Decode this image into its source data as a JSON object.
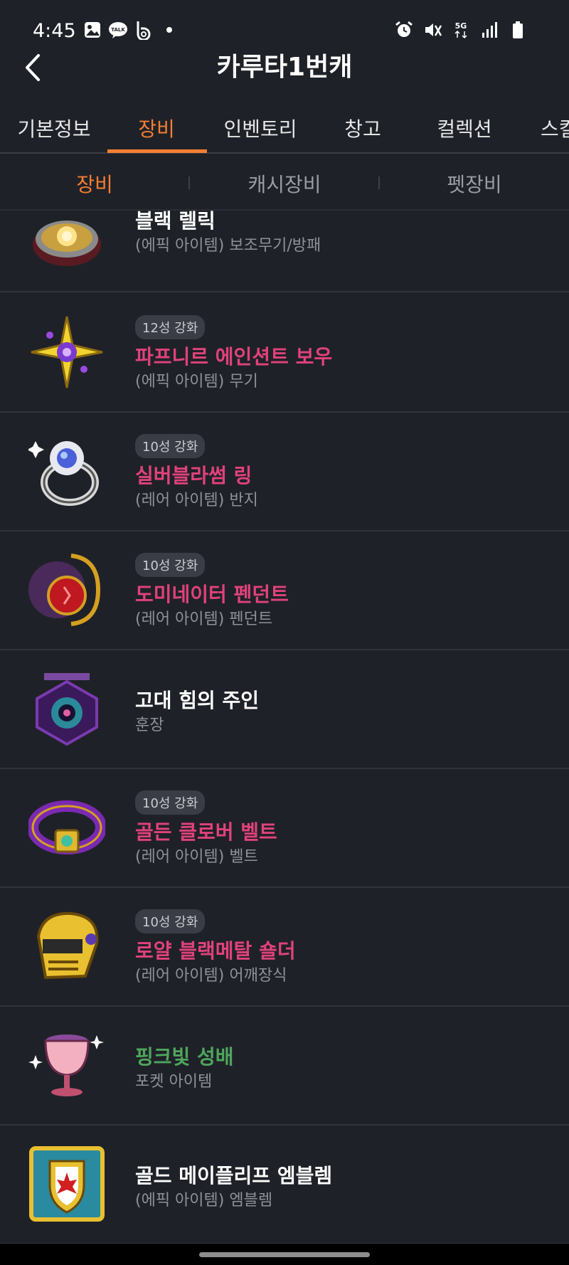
{
  "status": {
    "time": "4:45",
    "left_icons": [
      "gallery-icon",
      "kakaotalk-icon",
      "b-app-icon",
      "dot-icon"
    ],
    "talk_label": "TALK",
    "right_icons": [
      "alarm-icon",
      "mute-icon",
      "5g-icon",
      "signal-icon",
      "battery-icon"
    ],
    "network": "5G"
  },
  "header": {
    "title": "카루타1번캐"
  },
  "tabs": [
    {
      "label": "기본정보"
    },
    {
      "label": "장비"
    },
    {
      "label": "인벤토리"
    },
    {
      "label": "창고"
    },
    {
      "label": "컬렉션"
    },
    {
      "label": "스킬"
    }
  ],
  "active_tab": "장비",
  "subtabs": [
    {
      "label": "장비"
    },
    {
      "label": "캐시장비"
    },
    {
      "label": "펫장비"
    }
  ],
  "active_subtab": "장비",
  "items": [
    {
      "name": "블랙 렐릭",
      "sub": "(에픽 아이템) 보조무기/방패",
      "badge": "",
      "color": "white",
      "icon": "relic-icon"
    },
    {
      "name": "파프니르 에인션트 보우",
      "sub": "(에픽 아이템) 무기",
      "badge": "12성 강화",
      "color": "pink",
      "icon": "bow-icon"
    },
    {
      "name": "실버블라썸 링",
      "sub": "(레어 아이템) 반지",
      "badge": "10성 강화",
      "color": "pink",
      "icon": "ring-icon"
    },
    {
      "name": "도미네이터 펜던트",
      "sub": "(레어 아이템) 펜던트",
      "badge": "10성 강화",
      "color": "pink",
      "icon": "pendant-icon"
    },
    {
      "name": "고대 힘의 주인",
      "sub": "훈장",
      "badge": "",
      "color": "white",
      "icon": "medal-icon"
    },
    {
      "name": "골든 클로버 벨트",
      "sub": "(레어 아이템) 벨트",
      "badge": "10성 강화",
      "color": "pink",
      "icon": "belt-icon"
    },
    {
      "name": "로얄 블랙메탈 숄더",
      "sub": "(레어 아이템) 어깨장식",
      "badge": "10성 강화",
      "color": "pink",
      "icon": "shoulder-icon"
    },
    {
      "name": "핑크빛 성배",
      "sub": "포켓 아이템",
      "badge": "",
      "color": "green",
      "icon": "chalice-icon"
    },
    {
      "name": "골드 메이플리프 엠블렘",
      "sub": "(에픽 아이템) 엠블렘",
      "badge": "",
      "color": "white",
      "icon": "emblem-icon"
    }
  ],
  "colors": {
    "accent": "#f47f32",
    "background": "#1f2128",
    "pink_item": "#e0427a",
    "green_item": "#4ea65d",
    "badge_bg": "#3b3d46"
  }
}
